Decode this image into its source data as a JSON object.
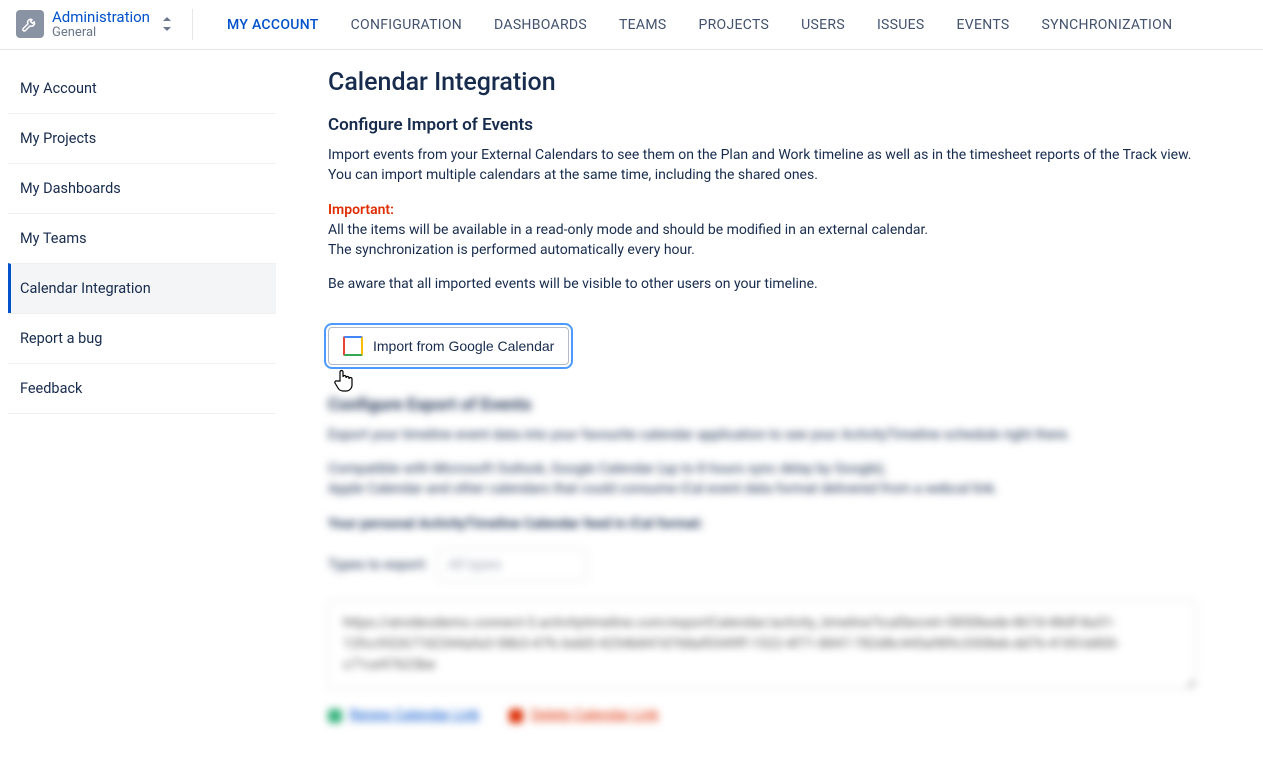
{
  "workspace": {
    "title": "Administration",
    "subtitle": "General"
  },
  "topnav": [
    {
      "label": "MY ACCOUNT",
      "active": true
    },
    {
      "label": "CONFIGURATION"
    },
    {
      "label": "DASHBOARDS"
    },
    {
      "label": "TEAMS"
    },
    {
      "label": "PROJECTS"
    },
    {
      "label": "USERS"
    },
    {
      "label": "ISSUES"
    },
    {
      "label": "EVENTS"
    },
    {
      "label": "SYNCHRONIZATION"
    }
  ],
  "sidebar": [
    {
      "label": "My Account"
    },
    {
      "label": "My Projects"
    },
    {
      "label": "My Dashboards"
    },
    {
      "label": "My Teams"
    },
    {
      "label": "Calendar Integration",
      "active": true
    },
    {
      "label": "Report a bug"
    },
    {
      "label": "Feedback"
    }
  ],
  "page": {
    "title": "Calendar Integration",
    "import_heading": "Configure Import of Events",
    "import_desc": "Import events from your External Calendars to see them on the Plan and Work timeline as well as in the timesheet reports of the Track view. You can import multiple calendars at the same time, including the shared ones.",
    "important_label": "Important:",
    "important_1": "All the items will be available in a read-only mode and should be modified in an external calendar.",
    "important_2": "The synchronization is performed automatically every hour.",
    "visibility_notice": "Be aware that all imported events will be visible to other users on your timeline.",
    "import_button": "Import from Google Calendar",
    "export_heading": "Configure Export of Events",
    "export_desc": "Export your timeline event data into your favourite calendar application to see your ActivityTimeline schedule right there.",
    "export_compat_1": "Compatible with Microsoft Outlook, Google Calendar (up to 8 hours sync delay by Google),",
    "export_compat_2": "Apple Calendar and other calendars that could consume iCal event data format delivered from a webcal link.",
    "export_feed_label": "Your personal ActivityTimeline Calendar feed in iCal format:",
    "types_label": "Types to export:",
    "types_value": "All types",
    "feed_url": "https://atvideodemo.connect-3.activitytimeline.com/exportCalendar/activity_timeline?icalSecret=5850bede-867d-48df-8a31-12fcc932677d2344afa3-58b3-47fc-bdd3-4254b847d768af0349ff-1522-4f71-8847-782d8c445a989c3308eb-dd76-4185-b800-c71ce97623be",
    "renew_link": "Renew Calendar Link",
    "delete_link": "Delete Calendar Link"
  }
}
